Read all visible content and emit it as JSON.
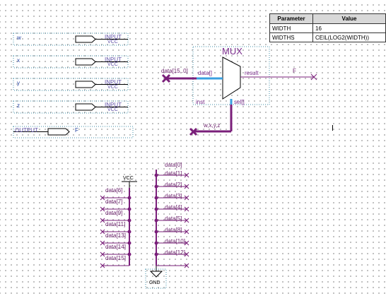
{
  "parameters": {
    "header": [
      "Parameter",
      "Value"
    ],
    "rows": [
      {
        "name": "WIDTH",
        "value": "16"
      },
      {
        "name": "WIDTHS",
        "value": "CEIL(LOG2(WIDTH))"
      }
    ]
  },
  "inputs": [
    {
      "name": "w",
      "type": "INPUT",
      "vcc": "VCC"
    },
    {
      "name": "x",
      "type": "INPUT",
      "vcc": "VCC"
    },
    {
      "name": "y",
      "type": "INPUT",
      "vcc": "VCC"
    },
    {
      "name": "z",
      "type": "INPUT",
      "vcc": "VCC"
    }
  ],
  "output": {
    "type": "OUTPUT",
    "name": "F"
  },
  "mux": {
    "title": "MUX",
    "port_data": "data[]",
    "port_result": "result",
    "port_sel": "sel[]",
    "instance": "inst",
    "data_net": "data[15..0]",
    "result_net": "F",
    "sel_net": "w,x,y,z"
  },
  "vcc_label": "VCC",
  "gnd_label": "GND",
  "vcc_nets": [
    "data[6]",
    "data[7]",
    "data[9]",
    "data[11]",
    "data[13]",
    "data[14]",
    "data[15]"
  ],
  "gnd_nets": [
    "data[0]",
    "data[1]",
    "data[2]",
    "data[3]",
    "data[4]",
    "data[5]",
    "data[8]",
    "data[10]",
    "data[12]"
  ]
}
